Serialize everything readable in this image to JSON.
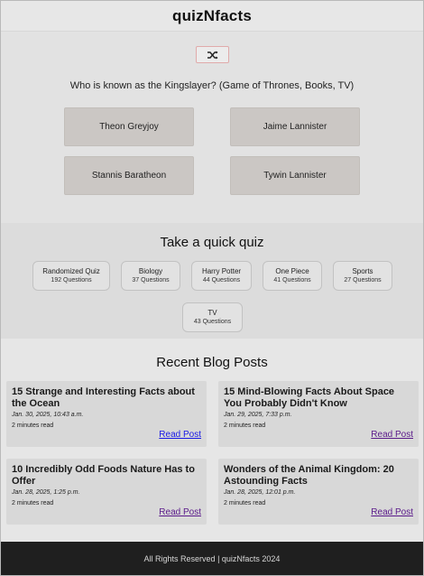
{
  "header": {
    "title": "quizNfacts"
  },
  "question": {
    "shuffle_icon": "shuffle-icon",
    "text": "Who is known as the Kingslayer? (Game of Thrones, Books, TV)",
    "answers": [
      "Theon Greyjoy",
      "Jaime Lannister",
      "Stannis Baratheon",
      "Tywin Lannister"
    ]
  },
  "quick_quiz": {
    "heading": "Take a quick quiz",
    "quizzes": [
      {
        "name": "Randomized Quiz",
        "count": "192 Questions"
      },
      {
        "name": "Biology",
        "count": "37 Questions"
      },
      {
        "name": "Harry Potter",
        "count": "44 Questions"
      },
      {
        "name": "One Piece",
        "count": "41 Questions"
      },
      {
        "name": "Sports",
        "count": "27 Questions"
      },
      {
        "name": "TV",
        "count": "43 Questions"
      }
    ]
  },
  "blog": {
    "heading": "Recent Blog Posts",
    "posts": [
      {
        "title": "15 Strange and Interesting Facts about the Ocean",
        "date": "Jan. 30, 2025, 10:43 a.m.",
        "read_time": "2 minutes read",
        "link": "Read Post"
      },
      {
        "title": "15 Mind-Blowing Facts About Space You Probably Didn't Know",
        "date": "Jan. 29, 2025, 7:33 p.m.",
        "read_time": "2 minutes read",
        "link": "Read Post"
      },
      {
        "title": "10 Incredibly Odd Foods Nature Has to Offer",
        "date": "Jan. 28, 2025, 1:25 p.m.",
        "read_time": "2 minutes read",
        "link": "Read Post"
      },
      {
        "title": "Wonders of the Animal Kingdom: 20 Astounding Facts",
        "date": "Jan. 28, 2025, 12:01 p.m.",
        "read_time": "2 minutes read",
        "link": "Read Post"
      }
    ]
  },
  "footer": {
    "text": "All Rights Reserved | quizNfacts 2024"
  },
  "colors": {
    "link_unvisited": "#1a1ae6",
    "link_visited": "#5a1a8a",
    "footer_bg": "#1f1f1f",
    "answer_bg": "#cbc7c4"
  }
}
